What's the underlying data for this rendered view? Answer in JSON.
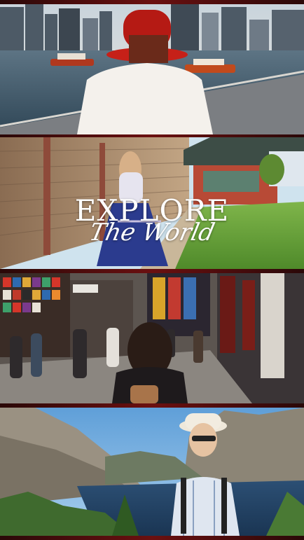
{
  "overlay": {
    "title": "EXPLORE",
    "subtitle": "The World"
  },
  "colors": {
    "accent": "#c62018",
    "frame_border": "#5a0f0f"
  },
  "panels": [
    {
      "scene": "harbor-city-skyline",
      "subject": "woman-in-red-hat"
    },
    {
      "scene": "palace-courtyard",
      "subject": "woman-in-hanbok"
    },
    {
      "scene": "busy-shopping-street",
      "subject": "woman-back-view"
    },
    {
      "scene": "mountain-lake-valley",
      "subject": "woman-in-sun-hat"
    }
  ]
}
